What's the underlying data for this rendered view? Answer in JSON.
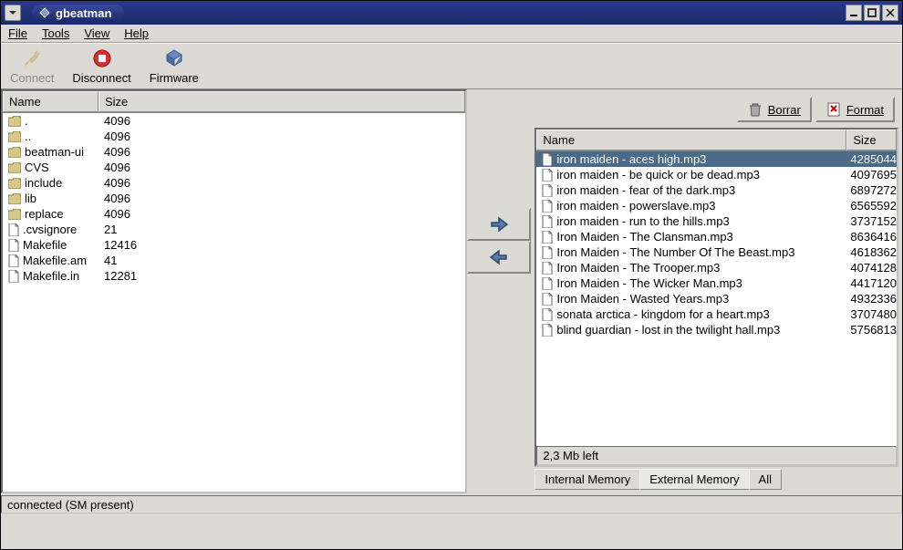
{
  "window": {
    "title": "gbeatman"
  },
  "menu": {
    "file": "File",
    "tools": "Tools",
    "view": "View",
    "help": "Help"
  },
  "toolbar": {
    "connect": "Connect",
    "disconnect": "Disconnect",
    "firmware": "Firmware"
  },
  "left": {
    "headers": {
      "name": "Name",
      "size": "Size"
    },
    "rows": [
      {
        "icon": "folder",
        "name": ".",
        "size": "4096"
      },
      {
        "icon": "folder",
        "name": "..",
        "size": "4096"
      },
      {
        "icon": "folder",
        "name": "beatman-ui",
        "size": "4096"
      },
      {
        "icon": "folder",
        "name": "CVS",
        "size": "4096"
      },
      {
        "icon": "folder",
        "name": "include",
        "size": "4096"
      },
      {
        "icon": "folder",
        "name": "lib",
        "size": "4096"
      },
      {
        "icon": "folder",
        "name": "replace",
        "size": "4096"
      },
      {
        "icon": "file",
        "name": ".cvsignore",
        "size": "21"
      },
      {
        "icon": "file",
        "name": "Makefile",
        "size": "12416"
      },
      {
        "icon": "file",
        "name": "Makefile.am",
        "size": "41"
      },
      {
        "icon": "file",
        "name": "Makefile.in",
        "size": "12281"
      }
    ]
  },
  "right": {
    "buttons": {
      "delete": "Borrar",
      "format": "Format"
    },
    "headers": {
      "name": "Name",
      "size": "Size"
    },
    "rows": [
      {
        "name": "iron maiden - aces high.mp3",
        "size": "4285044",
        "selected": true
      },
      {
        "name": "iron maiden - be quick or be dead.mp3",
        "size": "4097695"
      },
      {
        "name": "iron maiden - fear of the dark.mp3",
        "size": "6897272"
      },
      {
        "name": "iron maiden - powerslave.mp3",
        "size": "6565592"
      },
      {
        "name": "iron maiden - run to the hills.mp3",
        "size": "3737152"
      },
      {
        "name": "Iron Maiden - The Clansman.mp3",
        "size": "8636416"
      },
      {
        "name": "Iron Maiden - The Number Of The Beast.mp3",
        "size": "4618362"
      },
      {
        "name": "Iron Maiden - The Trooper.mp3",
        "size": "4074128"
      },
      {
        "name": "Iron Maiden - The Wicker Man.mp3",
        "size": "4417120"
      },
      {
        "name": "Iron Maiden - Wasted Years.mp3",
        "size": "4932336"
      },
      {
        "name": "sonata arctica - kingdom for a heart.mp3",
        "size": "3707480"
      },
      {
        "name": "blind guardian - lost in the twilight hall.mp3",
        "size": "5756813"
      }
    ],
    "space_left": "2,3 Mb left",
    "tabs": {
      "internal": "Internal Memory",
      "external": "External Memory",
      "all": "All"
    }
  },
  "status": "connected (SM present)"
}
